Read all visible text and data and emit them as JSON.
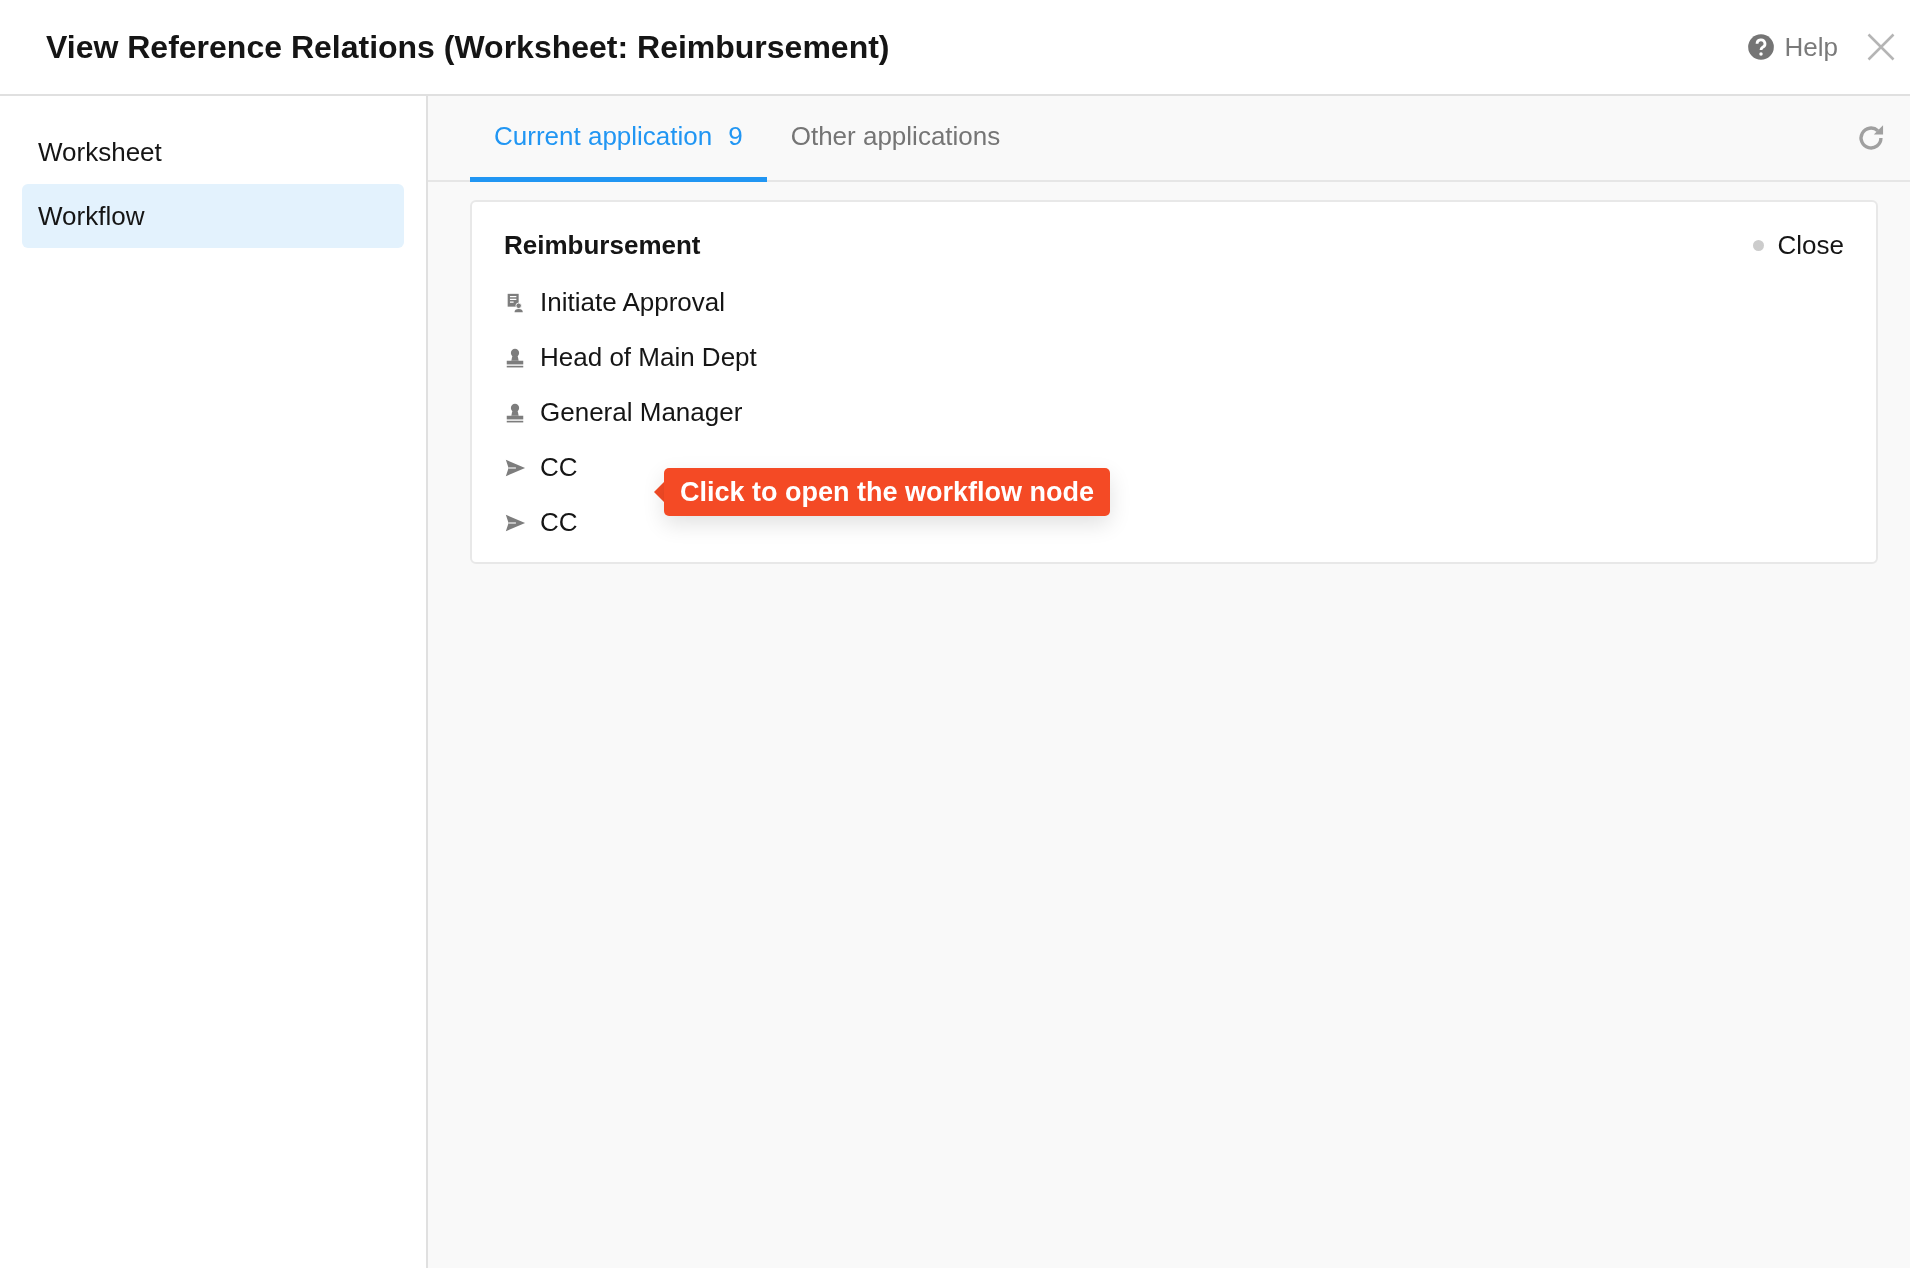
{
  "window": {
    "title": "View Reference Relations (Worksheet: Reimbursement)",
    "help": "Help"
  },
  "sidebar": {
    "items": [
      {
        "label": "Worksheet",
        "selected": false
      },
      {
        "label": "Workflow",
        "selected": true
      }
    ]
  },
  "tabs": [
    {
      "label": "Current application",
      "count": "9",
      "selected": true
    },
    {
      "label": "Other applications",
      "selected": false
    }
  ],
  "workflows": [
    {
      "name": "Reimbursement",
      "status": {
        "label": "Close",
        "on": false
      },
      "nodes": [
        {
          "kind": "start",
          "label": "Initiate Approval"
        },
        {
          "kind": "approver",
          "label": "Head of Main Dept"
        },
        {
          "kind": "approver",
          "label": "General Manager"
        },
        {
          "kind": "cc",
          "label": "CC"
        },
        {
          "kind": "cc",
          "label": "CC"
        }
      ]
    }
  ],
  "tooltip": {
    "text": "Click to open the workflow node"
  }
}
